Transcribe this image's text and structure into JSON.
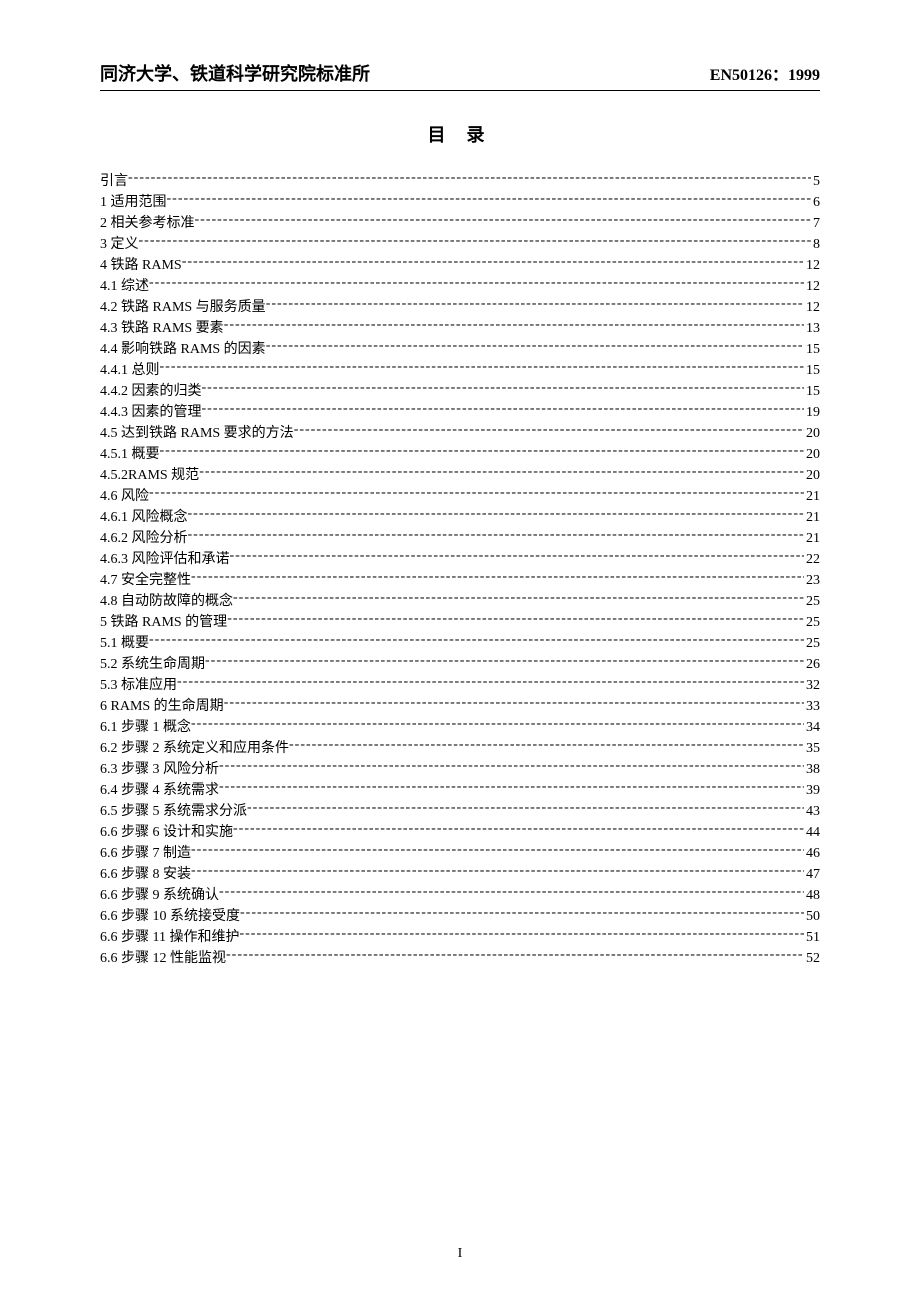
{
  "header": {
    "left": "同济大学、铁道科学研究院标准所",
    "right": "EN50126：1999"
  },
  "title": "目  录",
  "toc": [
    {
      "label": "引言",
      "page": "5"
    },
    {
      "label": "1 适用范围",
      "page": "6"
    },
    {
      "label": "2 相关参考标准",
      "page": "7"
    },
    {
      "label": "3  定义",
      "page": "8"
    },
    {
      "label": "4  铁路 RAMS",
      "page": "12"
    },
    {
      "label": "4.1 综述",
      "page": "12"
    },
    {
      "label": "4.2  铁路 RAMS 与服务质量",
      "page": "12"
    },
    {
      "label": "4.3  铁路 RAMS 要素",
      "page": "13"
    },
    {
      "label": "4.4  影响铁路 RAMS 的因素",
      "page": "15"
    },
    {
      "label": "4.4.1 总则",
      "page": "15"
    },
    {
      "label": "4.4.2  因素的归类",
      "page": "15"
    },
    {
      "label": "4.4.3  因素的管理",
      "page": "19"
    },
    {
      "label": "4.5 达到铁路 RAMS 要求的方法",
      "page": "20"
    },
    {
      "label": "4.5.1 概要",
      "page": "20"
    },
    {
      "label": "4.5.2RAMS 规范",
      "page": "20"
    },
    {
      "label": "4.6 风险",
      "page": "21"
    },
    {
      "label": "4.6.1 风险概念",
      "page": "21"
    },
    {
      "label": "4.6.2 风险分析",
      "page": "21"
    },
    {
      "label": "4.6.3 风险评估和承诺",
      "page": "22"
    },
    {
      "label": "4.7 安全完整性",
      "page": "23"
    },
    {
      "label": "4.8 自动防故障的概念",
      "page": "25"
    },
    {
      "label": "5 铁路 RAMS 的管理",
      "page": "25"
    },
    {
      "label": "5.1 概要",
      "page": "25"
    },
    {
      "label": "5.2 系统生命周期",
      "page": "26"
    },
    {
      "label": "5.3 标准应用",
      "page": "32"
    },
    {
      "label": "6 RAMS 的生命周期",
      "page": "33"
    },
    {
      "label": "6.1  步骤 1 概念",
      "page": "34"
    },
    {
      "label": "6.2 步骤 2 系统定义和应用条件",
      "page": "35"
    },
    {
      "label": "6.3 步骤 3  风险分析",
      "page": "38"
    },
    {
      "label": "6.4 步骤 4  系统需求",
      "page": "39"
    },
    {
      "label": "6.5 步骤 5  系统需求分派",
      "page": "43"
    },
    {
      "label": "6.6 步骤 6  设计和实施",
      "page": "44"
    },
    {
      "label": "6.6 步骤 7  制造",
      "page": "46"
    },
    {
      "label": "6.6 步骤 8  安装",
      "page": "47"
    },
    {
      "label": "6.6 步骤 9  系统确认",
      "page": "48"
    },
    {
      "label": "6.6 步骤 10  系统接受度",
      "page": "50"
    },
    {
      "label": "6.6 步骤 11  操作和维护",
      "page": "51"
    },
    {
      "label": "6.6 步骤 12  性能监视",
      "page": "52"
    }
  ],
  "pageNumber": "I"
}
